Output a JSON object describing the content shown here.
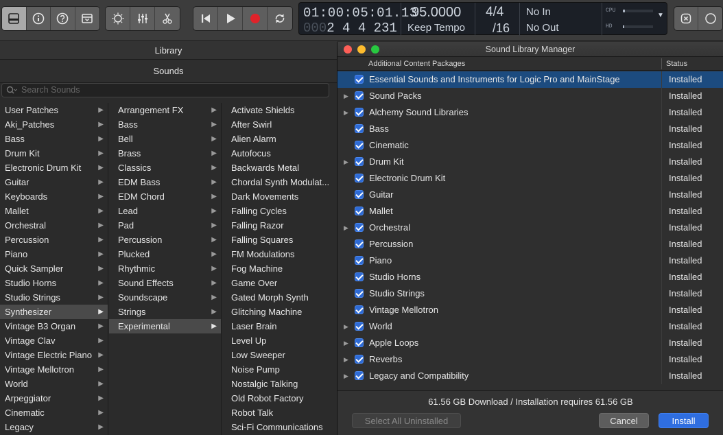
{
  "control_bar": {
    "lcd": {
      "time": "01:00:05:01.13",
      "bar_prefix": "000",
      "bar_pos": "2 4 4 231",
      "tempo": "95.0000",
      "tempo_mode": "Keep Tempo",
      "sig_top": "4/4",
      "sig_bottom": "/16",
      "midi_in": "No In",
      "midi_out": "No Out",
      "cpu_label": "CPU",
      "hd_label": "HD"
    }
  },
  "library": {
    "title": "Library",
    "sounds_header": "Sounds",
    "search_placeholder": "Search Sounds",
    "col1": [
      "User Patches",
      "Aki_Patches",
      "Bass",
      "Drum Kit",
      "Electronic Drum Kit",
      "Guitar",
      "Keyboards",
      "Mallet",
      "Orchestral",
      "Percussion",
      "Piano",
      "Quick Sampler",
      "Studio Horns",
      "Studio Strings",
      "Synthesizer",
      "Vintage B3 Organ",
      "Vintage Clav",
      "Vintage Electric Piano",
      "Vintage Mellotron",
      "World",
      "Arpeggiator",
      "Cinematic",
      "Legacy"
    ],
    "col2": [
      "Arrangement FX",
      "Bass",
      "Bell",
      "Brass",
      "Classics",
      "EDM Bass",
      "EDM Chord",
      "Lead",
      "Pad",
      "Percussion",
      "Plucked",
      "Rhythmic",
      "Sound Effects",
      "Soundscape",
      "Strings",
      "Experimental"
    ],
    "col3": [
      "Activate Shields",
      "After Swirl",
      "Alien Alarm",
      "Autofocus",
      "Backwards Metal",
      "Chordal Synth Modulat...",
      "Dark Movements",
      "Falling Cycles",
      "Falling Razor",
      "Falling Squares",
      "FM Modulations",
      "Fog Machine",
      "Game Over",
      "Gated Morph Synth",
      "Glitching Machine",
      "Laser Brain",
      "Level Up",
      "Low Sweeper",
      "Noise Pump",
      "Nostalgic Talking",
      "Old Robot Factory",
      "Robot Talk",
      "Sci-Fi Communications"
    ]
  },
  "dialog": {
    "title": "Sound Library Manager",
    "col_packages": "Additional Content Packages",
    "col_status": "Status",
    "rows": [
      {
        "name": "Essential Sounds and Instruments for Logic Pro and MainStage",
        "status": "Installed"
      },
      {
        "name": "Sound Packs",
        "status": "Installed"
      },
      {
        "name": "Alchemy Sound Libraries",
        "status": "Installed"
      },
      {
        "name": "Bass",
        "status": "Installed"
      },
      {
        "name": "Cinematic",
        "status": "Installed"
      },
      {
        "name": "Drum Kit",
        "status": "Installed"
      },
      {
        "name": "Electronic Drum Kit",
        "status": "Installed"
      },
      {
        "name": "Guitar",
        "status": "Installed"
      },
      {
        "name": "Mallet",
        "status": "Installed"
      },
      {
        "name": "Orchestral",
        "status": "Installed"
      },
      {
        "name": "Percussion",
        "status": "Installed"
      },
      {
        "name": "Piano",
        "status": "Installed"
      },
      {
        "name": "Studio Horns",
        "status": "Installed"
      },
      {
        "name": "Studio Strings",
        "status": "Installed"
      },
      {
        "name": "Vintage Mellotron",
        "status": "Installed"
      },
      {
        "name": "World",
        "status": "Installed"
      },
      {
        "name": "Apple Loops",
        "status": "Installed"
      },
      {
        "name": "Reverbs",
        "status": "Installed"
      },
      {
        "name": "Legacy and Compatibility",
        "status": "Installed"
      }
    ],
    "summary": "61.56 GB Download / Installation requires 61.56 GB",
    "select_all_label": "Select All Uninstalled",
    "cancel_label": "Cancel",
    "install_label": "Install"
  },
  "colors": {
    "accent": "#2f6ee0",
    "selection": "#1c4b7f",
    "record": "#e0232a"
  }
}
